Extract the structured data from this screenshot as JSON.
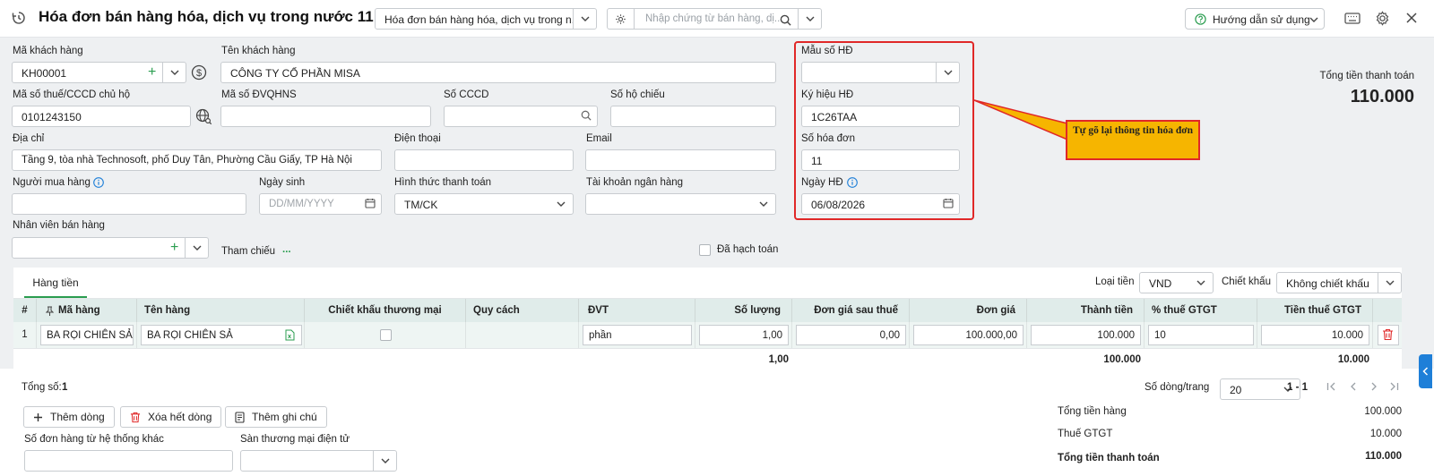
{
  "header": {
    "title": "Hóa đơn bán hàng hóa, dịch vụ trong nước 11",
    "template_select": "Hóa đơn bán hàng hóa, dịch vụ trong n...",
    "search_placeholder": "Nhập chứng từ bán hàng, dị...",
    "help_label": "Hướng dẫn sử dụng"
  },
  "form": {
    "customer_code_label": "Mã khách hàng",
    "customer_code": "KH00001",
    "customer_name_label": "Tên khách hàng",
    "customer_name": "CÔNG TY CỔ PHẦN MISA",
    "tax_code_label": "Mã số thuế/CCCD chủ hộ",
    "tax_code": "0101243150",
    "budget_code_label": "Mã số ĐVQHNS",
    "id_number_label": "Số CCCD",
    "passport_label": "Số hộ chiếu",
    "address_label": "Địa chỉ",
    "address": "Tầng 9, tòa nhà Technosoft, phố Duy Tân, Phường Cầu Giấy, TP Hà Nội",
    "phone_label": "Điện thoại",
    "email_label": "Email",
    "buyer_label": "Người mua hàng",
    "dob_label": "Ngày sinh",
    "dob_placeholder": "DD/MM/YYYY",
    "payment_method_label": "Hình thức thanh toán",
    "payment_method": "TM/CK",
    "bank_account_label": "Tài khoản ngân hàng",
    "sales_staff_label": "Nhân viên bán hàng",
    "reference_label": "Tham chiếu",
    "reference_more": "...",
    "posted_label": "Đã hạch toán"
  },
  "invoice": {
    "template_no_label": "Mẫu số HĐ",
    "symbol_label": "Ký hiệu HĐ",
    "symbol": "1C26TAA",
    "number_label": "Số hóa đơn",
    "number": "11",
    "date_label": "Ngày HĐ",
    "date": "06/08/2026"
  },
  "summary_top": {
    "label": "Tổng tiền thanh toán",
    "value": "110.000"
  },
  "callout": {
    "text": "Tự gõ lại thông tin hóa đơn"
  },
  "grid": {
    "tab_label": "Hàng tiền",
    "currency_label": "Loại tiền",
    "currency": "VND",
    "discount_label": "Chiết khấu",
    "discount": "Không chiết khấu",
    "columns": [
      "#",
      "Mã hàng",
      "Tên hàng",
      "Chiết khấu thương mại",
      "Quy cách",
      "ĐVT",
      "Số lượng",
      "Đơn giá sau thuế",
      "Đơn giá",
      "Thành tiền",
      "% thuế GTGT",
      "Tiền thuế GTGT"
    ],
    "rows": [
      {
        "no": "1",
        "code": "BA RỌI CHIÊN SẢ",
        "name": "BA RỌI CHIÊN SẢ",
        "unit": "phần",
        "qty": "1,00",
        "price_after_tax": "0,00",
        "price": "100.000,00",
        "amount": "100.000",
        "vat_rate": "10",
        "vat_amount": "10.000"
      }
    ],
    "totals": {
      "qty": "1,00",
      "amount": "100.000",
      "vat_amount": "10.000"
    }
  },
  "footer": {
    "count_label": "Tổng số:",
    "count": "1",
    "rows_per_page_label": "Số dòng/trang",
    "rows_per_page": "20",
    "page_range": "1 - 1",
    "add_row": "Thêm dòng",
    "clear_rows": "Xóa hết dòng",
    "add_note": "Thêm ghi chú",
    "external_order_label": "Số đơn hàng từ hệ thống khác",
    "ecommerce_label": "Sàn thương mại điện tử",
    "subtotal_label": "Tổng tiền hàng",
    "subtotal": "100.000",
    "vat_label": "Thuế GTGT",
    "vat": "10.000",
    "total_label": "Tổng tiền thanh toán",
    "total": "110.000"
  }
}
